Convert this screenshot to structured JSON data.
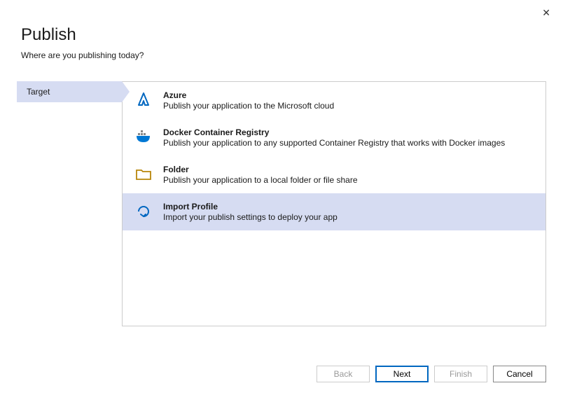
{
  "close_label": "✕",
  "header": {
    "title": "Publish",
    "subtitle": "Where are you publishing today?"
  },
  "sidebar": {
    "steps": [
      {
        "label": "Target",
        "active": true
      }
    ]
  },
  "options": [
    {
      "id": "azure",
      "title": "Azure",
      "desc": "Publish your application to the Microsoft cloud",
      "selected": false
    },
    {
      "id": "docker",
      "title": "Docker Container Registry",
      "desc": "Publish your application to any supported Container Registry that works with Docker images",
      "selected": false
    },
    {
      "id": "folder",
      "title": "Folder",
      "desc": "Publish your application to a local folder or file share",
      "selected": false
    },
    {
      "id": "import",
      "title": "Import Profile",
      "desc": "Import your publish settings to deploy your app",
      "selected": true
    }
  ],
  "buttons": {
    "back": "Back",
    "next": "Next",
    "finish": "Finish",
    "cancel": "Cancel"
  }
}
